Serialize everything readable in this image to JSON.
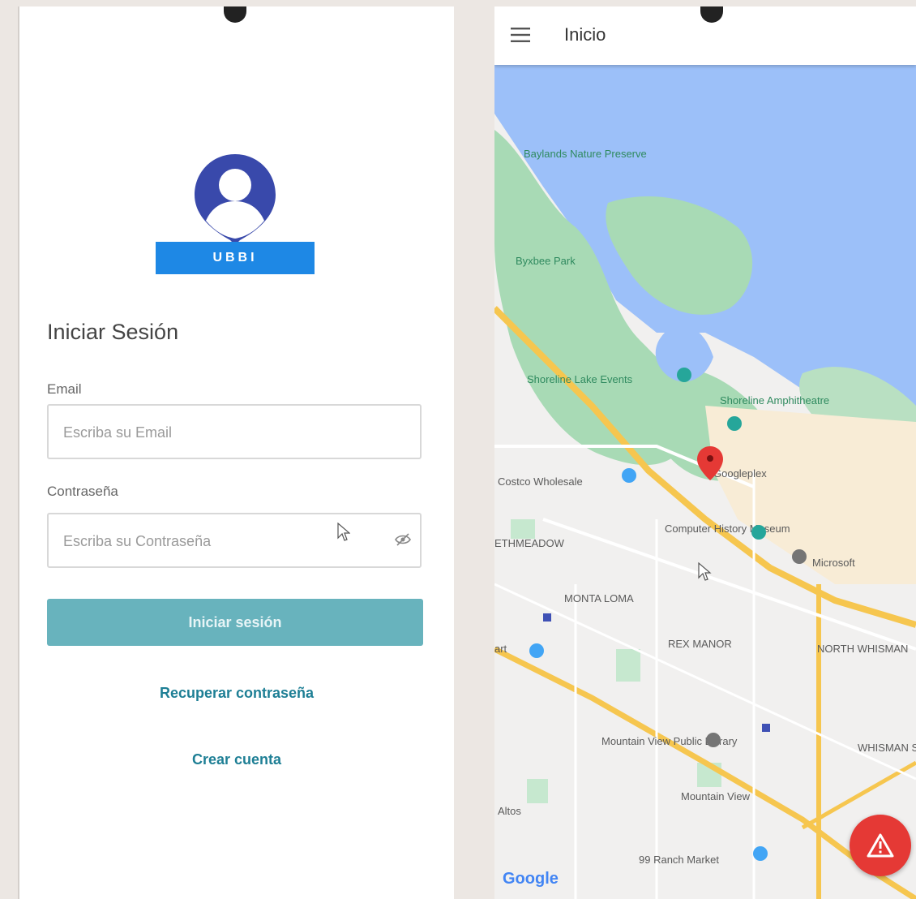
{
  "login": {
    "brand": "UBBI",
    "title": "Iniciar Sesión",
    "email_label": "Email",
    "email_placeholder": "Escriba su Email",
    "password_label": "Contraseña",
    "password_placeholder": "Escriba su Contraseña",
    "login_button": "Iniciar sesión",
    "recover_link": "Recuperar contraseña",
    "create_link": "Crear cuenta"
  },
  "home": {
    "title": "Inicio",
    "google": "Google",
    "places": {
      "baylands": "Baylands Nature Preserve",
      "byxbee": "Byxbee Park",
      "shoreline_lake": "Shoreline Lake Events",
      "amphitheatre": "Shoreline Amphitheatre",
      "googleplex": "Googleplex",
      "costco": "Costco Wholesale",
      "museum": "Computer History Museum",
      "microsoft": "Microsoft",
      "meadow": "ETHMEADOW",
      "monta_loma": "MONTA LOMA",
      "rex_manor": "REX MANOR",
      "north_whisman": "NORTH WHISMAN",
      "library": "Mountain View Public Library",
      "whisman_station": "WHISMAN STATION",
      "mountain_view": "Mountain View",
      "altos": "Altos",
      "ranch_market": "99 Ranch Market",
      "mart": "art"
    }
  },
  "colors": {
    "primary": "#3949ab",
    "brand_badge": "#1e88e5",
    "login_button": "#68b3bd",
    "link": "#1e7f95",
    "alert": "#e53935",
    "water": "#9cc0f9",
    "park": "#a8dab5"
  },
  "icons": [
    "user-pin-icon",
    "eye-off-icon",
    "menu-icon",
    "warning-icon",
    "map-pin-icon"
  ]
}
